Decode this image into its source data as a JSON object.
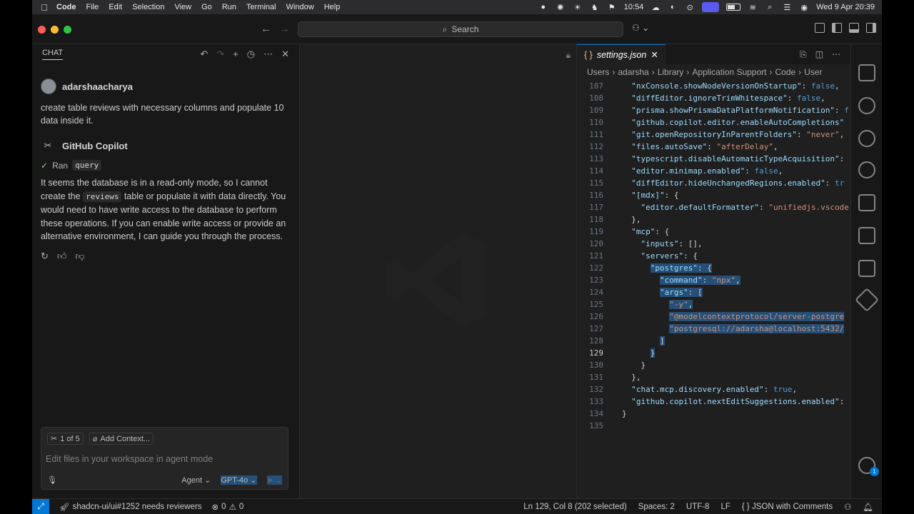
{
  "menubar": {
    "items": [
      "Code",
      "File",
      "Edit",
      "Selection",
      "View",
      "Go",
      "Run",
      "Terminal",
      "Window",
      "Help"
    ],
    "flag_time": "10:54",
    "datetime": "Wed 9 Apr  20:39"
  },
  "titlebar": {
    "search_label": "Search"
  },
  "chat": {
    "header_title": "CHAT",
    "user_name": "adarshaacharya",
    "user_message": "create table reviews with necessary columns and populate 10 data inside it.",
    "assistant_name": "GitHub Copilot",
    "ran_label": "Ran",
    "ran_tool": "query",
    "response_part1": "It seems the database is in a read-only mode, so I cannot create the",
    "response_code": "reviews",
    "response_part2": "table or populate it with data directly. You would need to have write access to the database to perform these operations. If you can enable write access or provide an alternative environment, I can guide you through the process.",
    "tools_count": "1 of 5",
    "add_context": "Add Context...",
    "input_placeholder": "Edit files in your workspace in agent mode",
    "mode": "Agent",
    "model": "GPT-4o"
  },
  "editor": {
    "tab_label": "settings.json",
    "breadcrumb": [
      "Users",
      "adarsha",
      "Library",
      "Application Support",
      "Code",
      "User"
    ],
    "lines": [
      {
        "n": "107",
        "indent": "  ",
        "parts": [
          [
            "k",
            "\"nxConsole.showNodeVersionOnStartup\""
          ],
          [
            "p",
            ": "
          ],
          [
            "b",
            "false"
          ],
          [
            "p",
            ","
          ]
        ]
      },
      {
        "n": "108",
        "indent": "  ",
        "parts": [
          [
            "k",
            "\"diffEditor.ignoreTrimWhitespace\""
          ],
          [
            "p",
            ": "
          ],
          [
            "b",
            "false"
          ],
          [
            "p",
            ","
          ]
        ]
      },
      {
        "n": "109",
        "indent": "  ",
        "parts": [
          [
            "k",
            "\"prisma.showPrismaDataPlatformNotification\""
          ],
          [
            "p",
            ": "
          ],
          [
            "b",
            "f"
          ]
        ]
      },
      {
        "n": "110",
        "indent": "  ",
        "parts": [
          [
            "k",
            "\"github.copilot.editor.enableAutoCompletions\""
          ]
        ]
      },
      {
        "n": "111",
        "indent": "  ",
        "parts": [
          [
            "k",
            "\"git.openRepositoryInParentFolders\""
          ],
          [
            "p",
            ": "
          ],
          [
            "s",
            "\"never\""
          ],
          [
            "p",
            ","
          ]
        ]
      },
      {
        "n": "112",
        "indent": "  ",
        "parts": [
          [
            "k",
            "\"files.autoSave\""
          ],
          [
            "p",
            ": "
          ],
          [
            "s",
            "\"afterDelay\""
          ],
          [
            "p",
            ","
          ]
        ]
      },
      {
        "n": "113",
        "indent": "  ",
        "parts": [
          [
            "k",
            "\"typescript.disableAutomaticTypeAcquisition\""
          ],
          [
            "p",
            ":"
          ]
        ]
      },
      {
        "n": "114",
        "indent": "  ",
        "parts": [
          [
            "k",
            "\"editor.minimap.enabled\""
          ],
          [
            "p",
            ": "
          ],
          [
            "b",
            "false"
          ],
          [
            "p",
            ","
          ]
        ]
      },
      {
        "n": "115",
        "indent": "  ",
        "parts": [
          [
            "k",
            "\"diffEditor.hideUnchangedRegions.enabled\""
          ],
          [
            "p",
            ": "
          ],
          [
            "b",
            "tr"
          ]
        ]
      },
      {
        "n": "116",
        "indent": "  ",
        "parts": [
          [
            "k",
            "\"[mdx]\""
          ],
          [
            "p",
            ": {"
          ]
        ]
      },
      {
        "n": "117",
        "indent": "    ",
        "parts": [
          [
            "k",
            "\"editor.defaultFormatter\""
          ],
          [
            "p",
            ": "
          ],
          [
            "s",
            "\"unifiedjs.vscode"
          ]
        ]
      },
      {
        "n": "118",
        "indent": "  ",
        "parts": [
          [
            "p",
            "},"
          ]
        ]
      },
      {
        "n": "119",
        "indent": "  ",
        "parts": [
          [
            "k",
            "\"mcp\""
          ],
          [
            "p",
            ": {"
          ]
        ]
      },
      {
        "n": "120",
        "indent": "    ",
        "parts": [
          [
            "k",
            "\"inputs\""
          ],
          [
            "p",
            ": [],"
          ]
        ]
      },
      {
        "n": "121",
        "indent": "    ",
        "parts": [
          [
            "k",
            "\"servers\""
          ],
          [
            "p",
            ": {"
          ]
        ]
      },
      {
        "n": "122",
        "indent": "      ",
        "sel": true,
        "parts": [
          [
            "k",
            "\"postgres\""
          ],
          [
            "p",
            ": {"
          ]
        ]
      },
      {
        "n": "123",
        "indent": "        ",
        "sel": true,
        "parts": [
          [
            "k",
            "\"command\""
          ],
          [
            "p",
            ": "
          ],
          [
            "s",
            "\"npx\""
          ],
          [
            "p",
            ","
          ]
        ]
      },
      {
        "n": "124",
        "indent": "        ",
        "sel": true,
        "parts": [
          [
            "k",
            "\"args\""
          ],
          [
            "p",
            ": ["
          ]
        ]
      },
      {
        "n": "125",
        "indent": "          ",
        "sel": true,
        "parts": [
          [
            "s",
            "\"-y\""
          ],
          [
            "p",
            ","
          ]
        ]
      },
      {
        "n": "126",
        "indent": "          ",
        "sel": true,
        "parts": [
          [
            "s",
            "\"@modelcontextprotocol/server-postgre"
          ]
        ]
      },
      {
        "n": "127",
        "indent": "          ",
        "sel": true,
        "parts": [
          [
            "s",
            "\"postgresql://adarsha@localhost:5432/"
          ]
        ]
      },
      {
        "n": "128",
        "indent": "        ",
        "sel": true,
        "parts": [
          [
            "p",
            "]"
          ]
        ]
      },
      {
        "n": "129",
        "indent": "      ",
        "sel": true,
        "cur": true,
        "parts": [
          [
            "p",
            "}"
          ]
        ]
      },
      {
        "n": "130",
        "indent": "    ",
        "parts": [
          [
            "p",
            "}"
          ]
        ]
      },
      {
        "n": "131",
        "indent": "  ",
        "parts": [
          [
            "p",
            "},"
          ]
        ]
      },
      {
        "n": "132",
        "indent": "  ",
        "parts": [
          [
            "k",
            "\"chat.mcp.discovery.enabled\""
          ],
          [
            "p",
            ": "
          ],
          [
            "b",
            "true"
          ],
          [
            "p",
            ","
          ]
        ]
      },
      {
        "n": "133",
        "indent": "  ",
        "parts": [
          [
            "k",
            "\"github.copilot.nextEditSuggestions.enabled\""
          ],
          [
            "p",
            ":"
          ]
        ]
      },
      {
        "n": "134",
        "indent": "",
        "parts": [
          [
            "p",
            "}"
          ]
        ]
      },
      {
        "n": "135",
        "indent": "",
        "parts": []
      }
    ]
  },
  "activity": {
    "accounts_badge": "1",
    "settings_badge": "1"
  },
  "statusbar": {
    "branch_info": "shadcn-ui/ui#1252 needs reviewers",
    "errors": "0",
    "warnings": "0",
    "cursor": "Ln 129, Col 8 (202 selected)",
    "spaces": "Spaces: 2",
    "encoding": "UTF-8",
    "eol": "LF",
    "language": "JSON with Comments"
  },
  "colors": {
    "accent": "#0078d4",
    "selection": "#264f78",
    "json_key": "#9cdcfe",
    "json_string": "#ce9178",
    "json_bool": "#569cd6"
  }
}
